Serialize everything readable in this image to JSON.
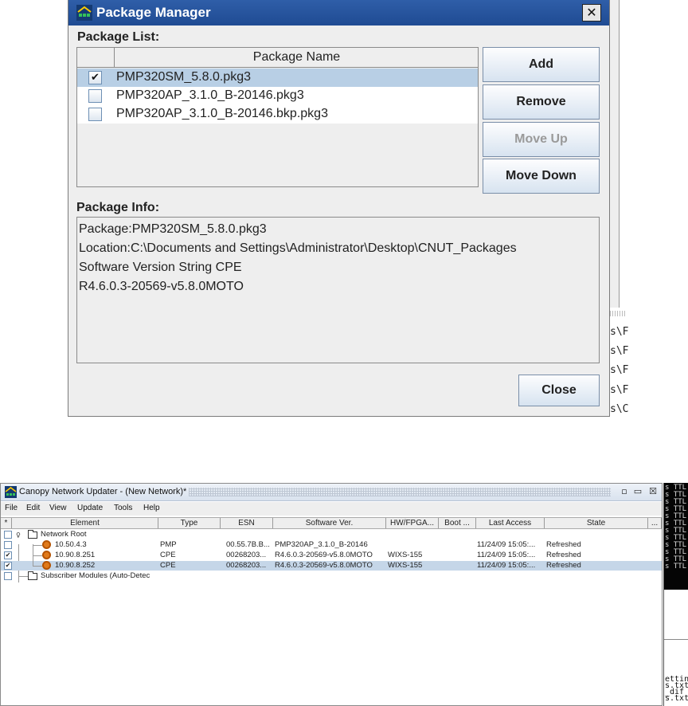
{
  "package_manager": {
    "title": "Package Manager",
    "close_glyph": "✕",
    "package_list_label": "Package List:",
    "column_header": "Package Name",
    "packages": [
      {
        "name": "PMP320SM_5.8.0.pkg3",
        "checked": true,
        "selected": true
      },
      {
        "name": "PMP320AP_3.1.0_B-20146.pkg3",
        "checked": false,
        "selected": false
      },
      {
        "name": "PMP320AP_3.1.0_B-20146.bkp.pkg3",
        "checked": false,
        "selected": false
      }
    ],
    "buttons": {
      "add": "Add",
      "remove": "Remove",
      "move_up": "Move Up",
      "move_down": "Move Down",
      "close": "Close"
    },
    "package_info_label": "Package Info:",
    "package_info": [
      "Package:PMP320SM_5.8.0.pkg3",
      "Location:C:\\Documents and Settings\\Administrator\\Desktop\\CNUT_Packages",
      "Software Version String CPE",
      "R4.6.0.3-20569-v5.8.0MOTO"
    ]
  },
  "background_paths": [
    "s\\F",
    "s\\F",
    "s\\F",
    "s\\F",
    "s\\C"
  ],
  "cnu": {
    "title": "Canopy Network Updater - (New Network)*",
    "window_buttons": [
      "▫",
      "▭",
      "☒"
    ],
    "menu": [
      "File",
      "Edit",
      "View",
      "Update",
      "Tools",
      "Help"
    ],
    "columns": [
      "*",
      "Element",
      "Type",
      "ESN",
      "Software Ver.",
      "HW/FPGA...",
      "Boot ...",
      "Last Access",
      "State",
      "..."
    ],
    "rows": [
      {
        "element": "Network Root",
        "type": "",
        "esn": "",
        "software": "",
        "hw": "",
        "boot": "",
        "last_access": "",
        "state": "",
        "checked": false,
        "kind": "folder-root"
      },
      {
        "element": "10.50.4.3",
        "type": "PMP",
        "esn": "00.55.7B.B...",
        "software": "PMP320AP_3.1.0_B-20146",
        "hw": "",
        "boot": "",
        "last_access": "11/24/09 15:05:...",
        "state": "Refreshed",
        "checked": false,
        "kind": "node"
      },
      {
        "element": "10.90.8.251",
        "type": "CPE",
        "esn": "00268203...",
        "software": "R4.6.0.3-20569-v5.8.0MOTO",
        "hw": "WIXS-155",
        "boot": "",
        "last_access": "11/24/09 15:05:...",
        "state": "Refreshed",
        "checked": true,
        "kind": "node"
      },
      {
        "element": "10.90.8.252",
        "type": "CPE",
        "esn": "00268203...",
        "software": "R4.6.0.3-20569-v5.8.0MOTO",
        "hw": "WIXS-155",
        "boot": "",
        "last_access": "11/24/09 15:05:...",
        "state": "Refreshed",
        "checked": true,
        "kind": "node",
        "selected": true
      },
      {
        "element": "Subscriber Modules (Auto-Detec",
        "type": "",
        "esn": "",
        "software": "",
        "hw": "",
        "boot": "",
        "last_access": "",
        "state": "",
        "checked": false,
        "kind": "folder"
      }
    ]
  },
  "terminal": {
    "top_lines": [
      "s TTL",
      "s TTL",
      "s TTL",
      "s TTL",
      "s TTL",
      "s TTL",
      "s TTL",
      "s TTL",
      "s TTL",
      "s TTL",
      "s TTL",
      "s TTL"
    ],
    "bottom_lines": [
      "ettin",
      "s.txt",
      "_dif",
      "s.txt"
    ]
  },
  "colors": {
    "title_bar": "#1f4b93",
    "selection": "#b8cfe5",
    "node_icon": "#e07a1a"
  },
  "icons": [
    "app-icon",
    "close-icon",
    "checkbox-icon",
    "folder-icon",
    "node-icon",
    "tree-expand-icon"
  ]
}
